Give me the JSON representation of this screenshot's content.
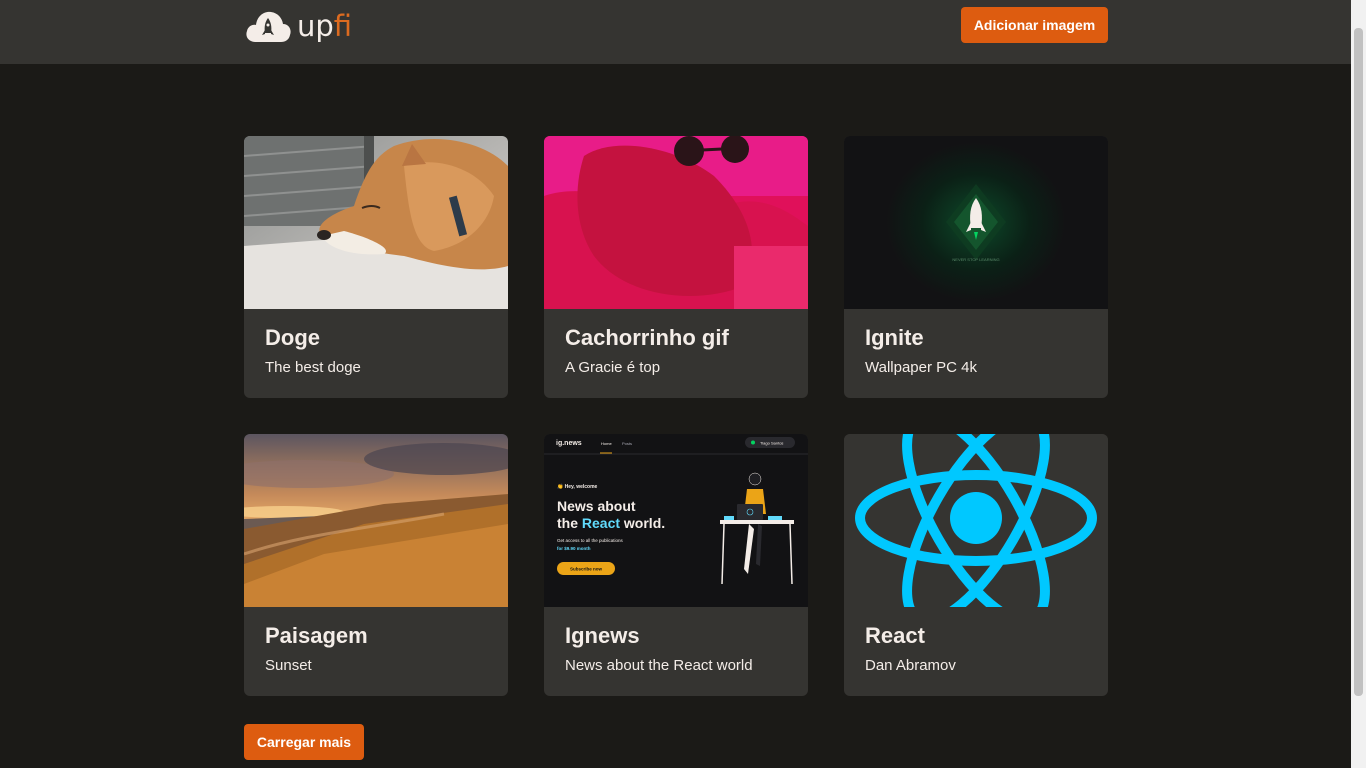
{
  "header": {
    "logo_main": "up",
    "logo_accent": "fi",
    "add_image_label": "Adicionar imagem"
  },
  "cards": [
    {
      "title": "Doge",
      "description": "The best doge",
      "image": "sleeping-shiba-dog"
    },
    {
      "title": "Cachorrinho gif",
      "description": "A Gracie é top",
      "image": "dog-with-sunglasses-pink"
    },
    {
      "title": "Ignite",
      "description": "Wallpaper PC 4k",
      "image": "green-rocket-wallpaper"
    },
    {
      "title": "Paisagem",
      "description": "Sunset",
      "image": "beach-sunset-landscape"
    },
    {
      "title": "Ignews",
      "description": "News about the React world",
      "image": "ignews-site-screenshot"
    },
    {
      "title": "React",
      "description": "Dan Abramov",
      "image": "react-logo"
    }
  ],
  "ignews_preview": {
    "brand": "ig.news",
    "nav_home": "Home",
    "nav_posts": "Posts",
    "user": "Tiago Santos",
    "welcome": "👏 Hey, welcome",
    "headline_1": "News about",
    "headline_2_pre": "the ",
    "headline_2_accent": "React",
    "headline_2_post": " world.",
    "sub": "Get access to all the publications",
    "price": "for $9.90 month",
    "cta": "Subscribe now"
  },
  "ignite_preview": {
    "tagline": "NEVER STOP LEARNING"
  },
  "load_more_label": "Carregar mais",
  "colors": {
    "background": "#1b1a17",
    "header": "#353431",
    "card": "#353431",
    "accent": "#dd5c10",
    "text": "#f4ede8"
  }
}
